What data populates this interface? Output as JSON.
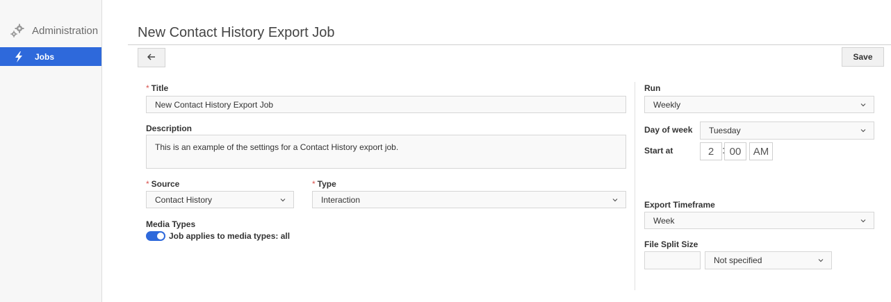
{
  "sidebar": {
    "header": {
      "label": "Administration",
      "icon": "gears-icon"
    },
    "items": [
      {
        "label": "Jobs",
        "icon": "lightning-bolt-icon",
        "active": true
      }
    ]
  },
  "page": {
    "title": "New Contact History Export Job",
    "save_label": "Save",
    "back_icon": "arrow-left-icon"
  },
  "form": {
    "title": {
      "label": "Title",
      "required": true,
      "value": "New Contact History Export Job"
    },
    "description": {
      "label": "Description",
      "value": "This is an example of the settings for a Contact History export job."
    },
    "source": {
      "label": "Source",
      "required": true,
      "value": "Contact History"
    },
    "type": {
      "label": "Type",
      "required": true,
      "value": "Interaction"
    },
    "media_types": {
      "label": "Media Types",
      "toggle_label": "Job applies to media types: all",
      "enabled": true
    }
  },
  "schedule": {
    "run": {
      "label": "Run",
      "value": "Weekly"
    },
    "day_of_week": {
      "label": "Day of week",
      "value": "Tuesday"
    },
    "start_at": {
      "label": "Start at",
      "hour": "2",
      "minute": "00",
      "ampm": "AM"
    },
    "export_timeframe": {
      "label": "Export Timeframe",
      "value": "Week"
    },
    "file_split_size": {
      "label": "File Split Size",
      "size_value": "",
      "unit_value": "Not specified"
    }
  },
  "colors": {
    "accent": "#2e69db",
    "required_marker": "#d9534f"
  }
}
